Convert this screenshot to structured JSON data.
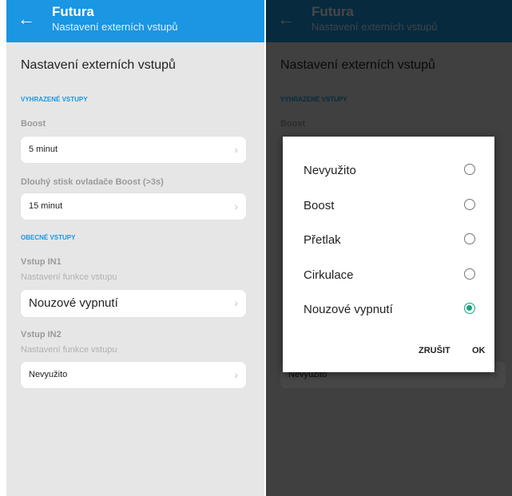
{
  "app": {
    "title": "Futura",
    "subtitle": "Nastavení externích vstupů",
    "back_icon": "arrow-left-icon"
  },
  "page": {
    "title": "Nastavení externích vstupů"
  },
  "reserved": {
    "header": "VYHRAZENÉ VSTUPY",
    "boost": {
      "label": "Boost",
      "value": "5 minut"
    },
    "long_press": {
      "label": "Dlouhý stisk ovladače Boost (>3s)",
      "value": "15 minut"
    }
  },
  "general": {
    "header": "OBECNÉ VSTUPY",
    "in1": {
      "label": "Vstup IN1",
      "sublabel": "Nastavení funkce vstupu",
      "value": "Nouzové vypnutí"
    },
    "in2": {
      "label": "Vstup IN2",
      "sublabel": "Nastavení funkce vstupu",
      "value": "Nevyužito"
    }
  },
  "dialog": {
    "options": [
      "Nevyužito",
      "Boost",
      "Přetlak",
      "Cirkulace",
      "Nouzové vypnutí"
    ],
    "selected_index": 4,
    "cancel_label": "ZRUŠIT",
    "ok_label": "OK"
  },
  "colors": {
    "accent": "#1a96e2",
    "radio_selected": "#16a37f",
    "background": "#e6e6e6"
  }
}
